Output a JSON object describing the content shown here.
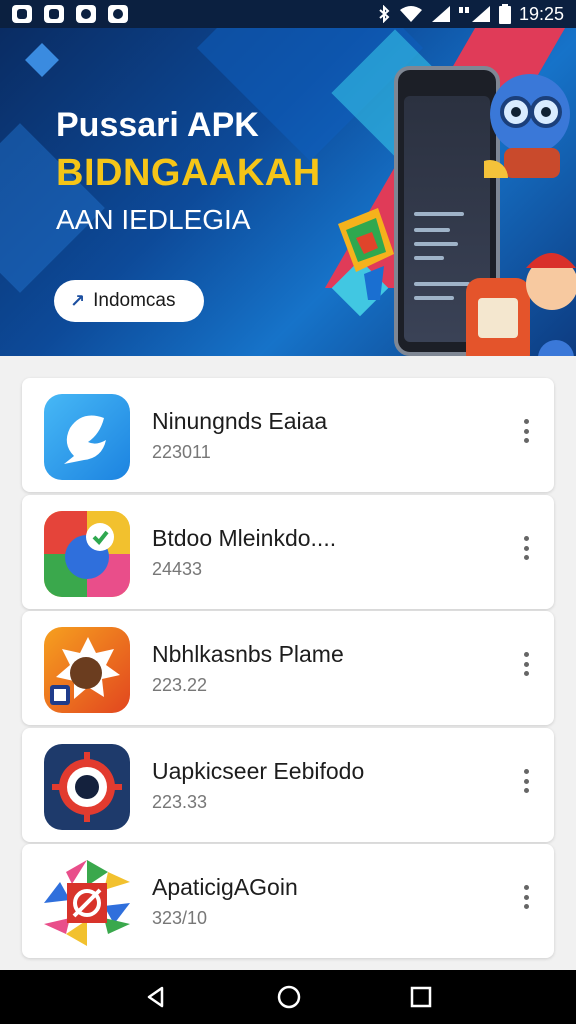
{
  "status_bar": {
    "time": "19:25",
    "icons": [
      "notification-icon",
      "gallery-icon",
      "messenger-icon",
      "chat-icon",
      "bluetooth-icon",
      "wifi-icon",
      "signal-icon",
      "battery-icon"
    ]
  },
  "banner": {
    "title": "Pussari APK",
    "headline": "BIDNGAAKAH",
    "subtitle": "AAN IEDLEGIA",
    "button_label": "Indomcas"
  },
  "apps": [
    {
      "name": "Ninungnds Eaiaa",
      "meta": "223011",
      "icon": "bird-chat-icon",
      "color": "#2b9be8"
    },
    {
      "name": "Btdoo Mleinkdo....",
      "meta": "24433",
      "icon": "colorful-check-icon",
      "color": "#e94a3a"
    },
    {
      "name": "Nbhlkasnbs Plame",
      "meta": "223.22",
      "icon": "fruit-game-icon",
      "color": "#f07b1e"
    },
    {
      "name": "Uapkicseer Eebifodo",
      "meta": "223.33",
      "icon": "target-eye-icon",
      "color": "#1e3a6b"
    },
    {
      "name": "ApaticigAGoin",
      "meta": "323/10",
      "icon": "compass-game-icon",
      "color": "#d8332a"
    }
  ],
  "nav": {
    "icons": [
      "back-icon",
      "home-icon",
      "recents-icon"
    ]
  }
}
